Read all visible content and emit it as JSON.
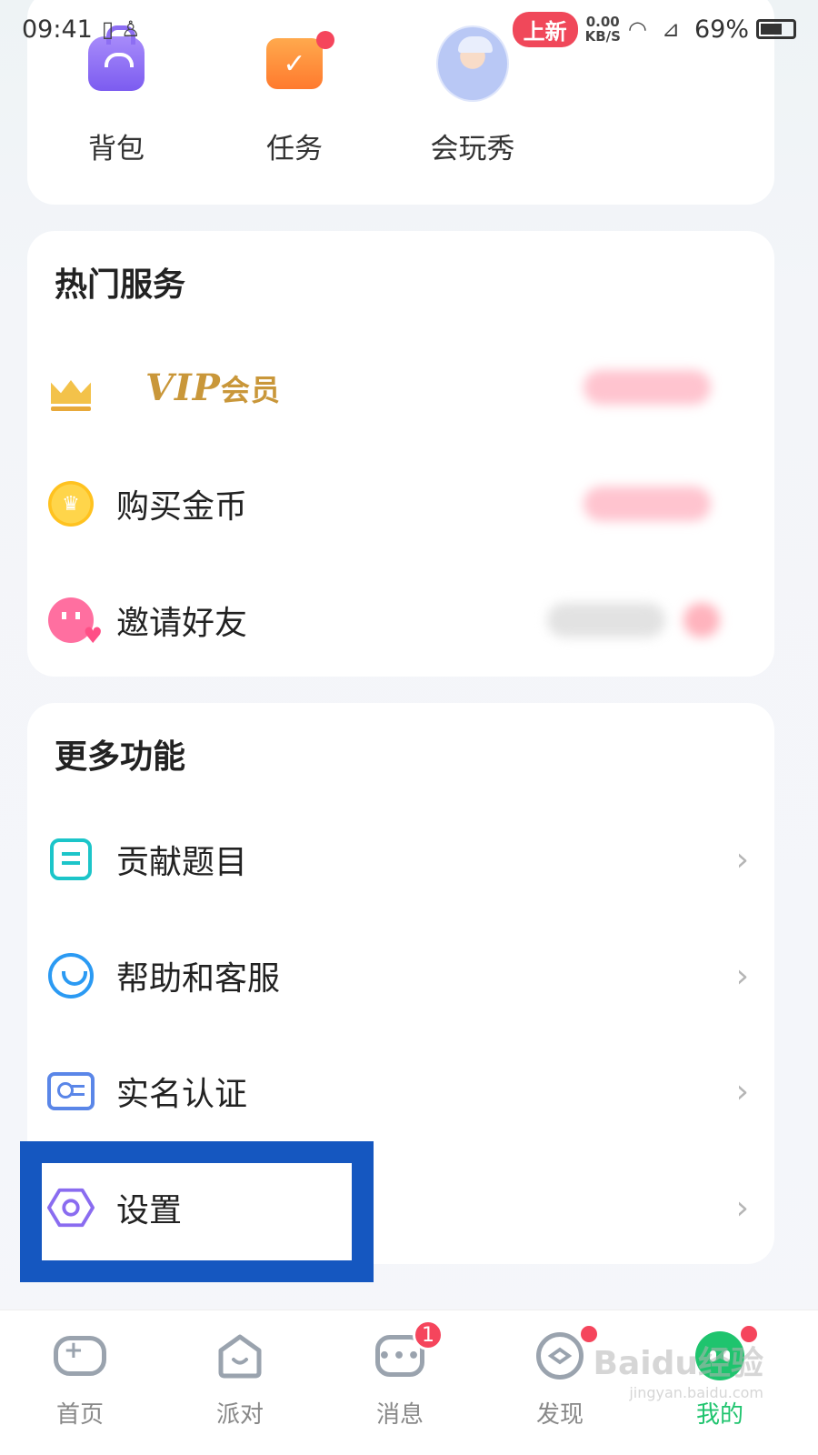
{
  "status_bar": {
    "time": "09:41",
    "new_badge": "上新",
    "net_speed": "0.00",
    "net_unit": "KB/S",
    "battery": "69%"
  },
  "top_shortcuts": [
    {
      "label": "背包",
      "icon": "backpack-icon"
    },
    {
      "label": "任务",
      "icon": "task-calendar-icon",
      "has_dot": true
    },
    {
      "label": "会玩秀",
      "icon": "avatar-show-icon"
    }
  ],
  "hot_services": {
    "title": "热门服务",
    "vip": {
      "label": "VIP",
      "suffix": "会员"
    },
    "items": [
      {
        "label": "购买金币",
        "icon": "coin-icon"
      },
      {
        "label": "邀请好友",
        "icon": "invite-friend-icon"
      }
    ]
  },
  "more_features": {
    "title": "更多功能",
    "items": [
      {
        "label": "贡献题目",
        "icon": "contribute-question-icon"
      },
      {
        "label": "帮助和客服",
        "icon": "help-service-icon"
      },
      {
        "label": "实名认证",
        "icon": "id-verify-icon"
      },
      {
        "label": "设置",
        "icon": "settings-hex-icon"
      }
    ]
  },
  "tabbar": [
    {
      "label": "首页",
      "icon": "gamepad-icon"
    },
    {
      "label": "派对",
      "icon": "party-house-icon"
    },
    {
      "label": "消息",
      "icon": "message-bubble-icon",
      "badge": "1"
    },
    {
      "label": "发现",
      "icon": "compass-icon",
      "has_dot": true
    },
    {
      "label": "我的",
      "icon": "me-icon",
      "has_dot": true,
      "active": true
    }
  ],
  "watermark": {
    "text": "Baidu经验",
    "sub": "jingyan.baidu.com"
  },
  "colors": {
    "accent_green": "#1fc46e",
    "highlight_blue": "#1557c0",
    "badge_red": "#f5455c",
    "vip_gold": "#c9973a"
  }
}
